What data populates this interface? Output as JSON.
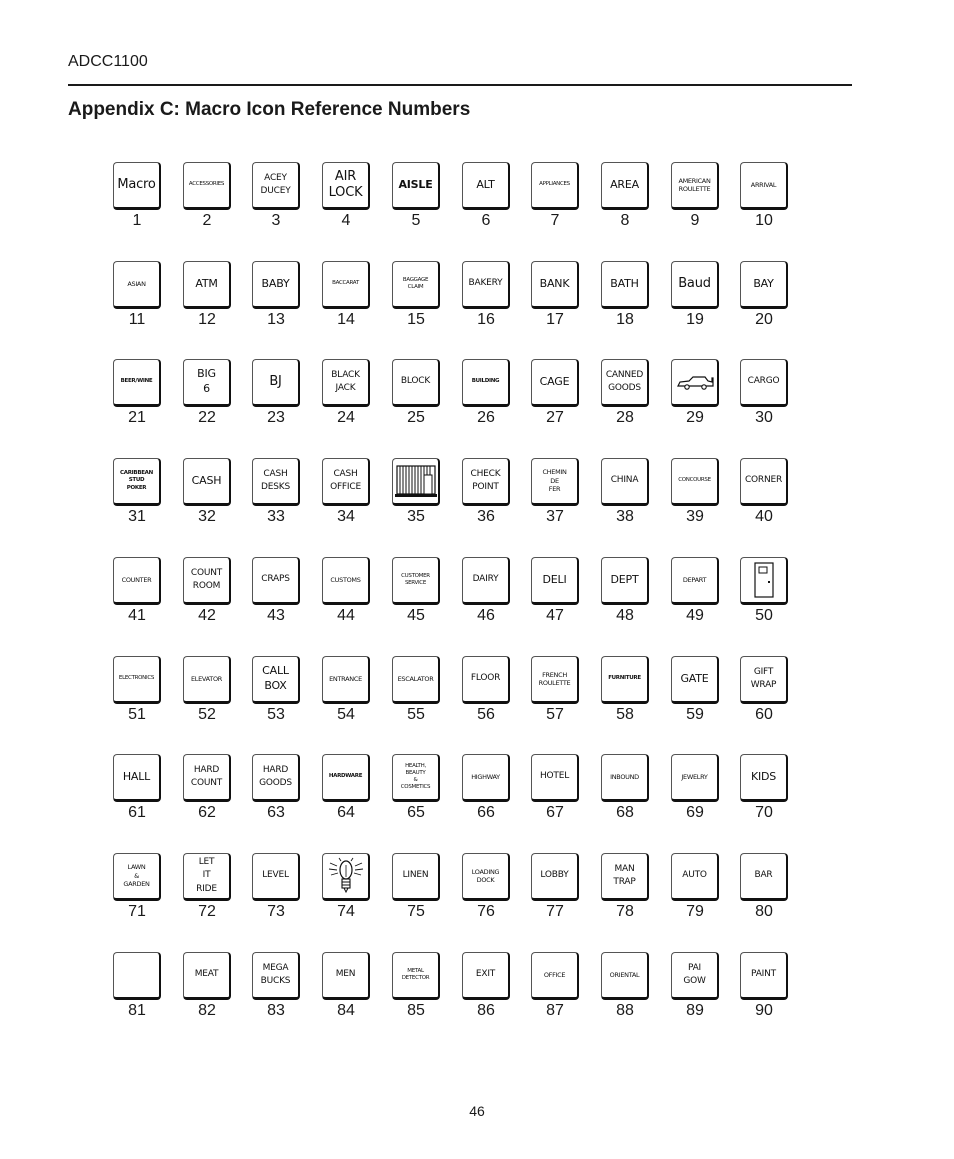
{
  "header": {
    "doc_id": "ADCC1100",
    "title": "Appendix C: Macro Icon Reference Numbers"
  },
  "footer": {
    "page_number": "46"
  },
  "icons": [
    {
      "num": "1",
      "label": "Macro",
      "size": "l"
    },
    {
      "num": "2",
      "label": "ACCESSORIES",
      "size": "xxs"
    },
    {
      "num": "3",
      "label": "ACEY\nDUCEY",
      "size": "s"
    },
    {
      "num": "4",
      "label": "AIR\nLOCK",
      "size": "l"
    },
    {
      "num": "5",
      "label": "AISLE",
      "size": "m",
      "bold": true
    },
    {
      "num": "6",
      "label": "ALT",
      "size": "m"
    },
    {
      "num": "7",
      "label": "APPLIANCES",
      "size": "xxs"
    },
    {
      "num": "8",
      "label": "AREA",
      "size": "m"
    },
    {
      "num": "9",
      "label": "AMERICAN\nROULETTE",
      "size": "xs"
    },
    {
      "num": "10",
      "label": "ARRIVAL",
      "size": "xs"
    },
    {
      "num": "11",
      "label": "ASIAN",
      "size": "xs"
    },
    {
      "num": "12",
      "label": "ATM",
      "size": "m"
    },
    {
      "num": "13",
      "label": "BABY",
      "size": "m"
    },
    {
      "num": "14",
      "label": "BACCARAT",
      "size": "xxs"
    },
    {
      "num": "15",
      "label": "BAGGAGE\nCLAIM",
      "size": "xxs"
    },
    {
      "num": "16",
      "label": "BAKERY",
      "size": "s"
    },
    {
      "num": "17",
      "label": "BANK",
      "size": "m"
    },
    {
      "num": "18",
      "label": "BATH",
      "size": "m"
    },
    {
      "num": "19",
      "label": "Baud",
      "size": "l"
    },
    {
      "num": "20",
      "label": "BAY",
      "size": "m"
    },
    {
      "num": "21",
      "label": "BEER/WINE",
      "size": "xxs",
      "bold": true
    },
    {
      "num": "22",
      "label": "BIG\n6",
      "size": "m"
    },
    {
      "num": "23",
      "label": "BJ",
      "size": "l"
    },
    {
      "num": "24",
      "label": "BLACK\nJACK",
      "size": "s"
    },
    {
      "num": "25",
      "label": "BLOCK",
      "size": "s"
    },
    {
      "num": "26",
      "label": "BUILDING",
      "size": "xxs",
      "bold": true
    },
    {
      "num": "27",
      "label": "CAGE",
      "size": "m"
    },
    {
      "num": "28",
      "label": "CANNED\nGOODS",
      "size": "s"
    },
    {
      "num": "29",
      "label": "",
      "size": "m",
      "graphic": "car"
    },
    {
      "num": "30",
      "label": "CARGO",
      "size": "s"
    },
    {
      "num": "31",
      "label": "CARIBBEAN\nSTUD\nPOKER",
      "size": "xxs",
      "bold": true
    },
    {
      "num": "32",
      "label": "CASH",
      "size": "m"
    },
    {
      "num": "33",
      "label": "CASH\nDESKS",
      "size": "s"
    },
    {
      "num": "34",
      "label": "CASH\nOFFICE",
      "size": "s"
    },
    {
      "num": "35",
      "label": "",
      "size": "m",
      "graphic": "cage"
    },
    {
      "num": "36",
      "label": "CHECK\nPOINT",
      "size": "s"
    },
    {
      "num": "37",
      "label": "CHEMIN\nDE\nFER",
      "size": "xs"
    },
    {
      "num": "38",
      "label": "CHINA",
      "size": "s"
    },
    {
      "num": "39",
      "label": "CONCOURSE",
      "size": "xxs"
    },
    {
      "num": "40",
      "label": "CORNER",
      "size": "s"
    },
    {
      "num": "41",
      "label": "COUNTER",
      "size": "xs"
    },
    {
      "num": "42",
      "label": "COUNT\nROOM",
      "size": "s"
    },
    {
      "num": "43",
      "label": "CRAPS",
      "size": "s"
    },
    {
      "num": "44",
      "label": "CUSTOMS",
      "size": "xs"
    },
    {
      "num": "45",
      "label": "CUSTOMER\nSERVICE",
      "size": "xxs"
    },
    {
      "num": "46",
      "label": "DAIRY",
      "size": "s"
    },
    {
      "num": "47",
      "label": "DELI",
      "size": "m"
    },
    {
      "num": "48",
      "label": "DEPT",
      "size": "m"
    },
    {
      "num": "49",
      "label": "DEPART",
      "size": "xs"
    },
    {
      "num": "50",
      "label": "",
      "size": "m",
      "graphic": "door"
    },
    {
      "num": "51",
      "label": "ELECTRONICS",
      "size": "xxs"
    },
    {
      "num": "52",
      "label": "ELEVATOR",
      "size": "xs"
    },
    {
      "num": "53",
      "label": "CALL\nBOX",
      "size": "m"
    },
    {
      "num": "54",
      "label": "ENTRANCE",
      "size": "xs"
    },
    {
      "num": "55",
      "label": "ESCALATOR",
      "size": "xs"
    },
    {
      "num": "56",
      "label": "FLOOR",
      "size": "s"
    },
    {
      "num": "57",
      "label": "FRENCH\nROULETTE",
      "size": "xs"
    },
    {
      "num": "58",
      "label": "FURNITURE",
      "size": "xxs",
      "bold": true
    },
    {
      "num": "59",
      "label": "GATE",
      "size": "m"
    },
    {
      "num": "60",
      "label": "GIFT\nWRAP",
      "size": "s"
    },
    {
      "num": "61",
      "label": "HALL",
      "size": "m"
    },
    {
      "num": "62",
      "label": "HARD\nCOUNT",
      "size": "s"
    },
    {
      "num": "63",
      "label": "HARD\nGOODS",
      "size": "s"
    },
    {
      "num": "64",
      "label": "HARDWARE",
      "size": "xxs",
      "bold": true
    },
    {
      "num": "65",
      "label": "HEALTH,\nBEAUTY\n&\nCOSMETICS",
      "size": "xxs"
    },
    {
      "num": "66",
      "label": "HIGHWAY",
      "size": "xs"
    },
    {
      "num": "67",
      "label": "HOTEL",
      "size": "s"
    },
    {
      "num": "68",
      "label": "INBOUND",
      "size": "xs"
    },
    {
      "num": "69",
      "label": "JEWELRY",
      "size": "xs"
    },
    {
      "num": "70",
      "label": "KIDS",
      "size": "m"
    },
    {
      "num": "71",
      "label": "LAWN\n&\nGARDEN",
      "size": "xs"
    },
    {
      "num": "72",
      "label": "LET\nIT\nRIDE",
      "size": "s"
    },
    {
      "num": "73",
      "label": "LEVEL",
      "size": "s"
    },
    {
      "num": "74",
      "label": "",
      "size": "m",
      "graphic": "lightbulb"
    },
    {
      "num": "75",
      "label": "LINEN",
      "size": "s"
    },
    {
      "num": "76",
      "label": "LOADING\nDOCK",
      "size": "xs"
    },
    {
      "num": "77",
      "label": "LOBBY",
      "size": "s"
    },
    {
      "num": "78",
      "label": "MAN\nTRAP",
      "size": "s"
    },
    {
      "num": "79",
      "label": "AUTO",
      "size": "s"
    },
    {
      "num": "80",
      "label": "BAR",
      "size": "s"
    },
    {
      "num": "81",
      "label": "",
      "size": "m"
    },
    {
      "num": "82",
      "label": "MEAT",
      "size": "s"
    },
    {
      "num": "83",
      "label": "MEGA\nBUCKS",
      "size": "s"
    },
    {
      "num": "84",
      "label": "MEN",
      "size": "s"
    },
    {
      "num": "85",
      "label": "METAL\nDETECTOR",
      "size": "xxs"
    },
    {
      "num": "86",
      "label": "EXIT",
      "size": "s"
    },
    {
      "num": "87",
      "label": "OFFICE",
      "size": "xs"
    },
    {
      "num": "88",
      "label": "ORIENTAL",
      "size": "xs"
    },
    {
      "num": "89",
      "label": "PAI\nGOW",
      "size": "s"
    },
    {
      "num": "90",
      "label": "PAINT",
      "size": "s"
    }
  ]
}
